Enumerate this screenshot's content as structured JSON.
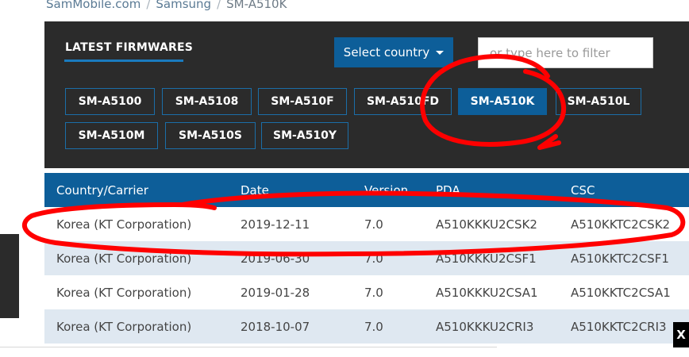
{
  "breadcrumb": {
    "home": "SamMobile.com",
    "brand": "Samsung",
    "model": "SM-A510K"
  },
  "panel": {
    "title": "LATEST FIRMWARES",
    "country_button": "Select country",
    "filter_placeholder": "or type here to filter",
    "models": [
      {
        "label": "SM-A5100",
        "active": false
      },
      {
        "label": "SM-A5108",
        "active": false
      },
      {
        "label": "SM-A510F",
        "active": false
      },
      {
        "label": "SM-A510FD",
        "active": false
      },
      {
        "label": "SM-A510K",
        "active": true
      },
      {
        "label": "SM-A510L",
        "active": false
      },
      {
        "label": "SM-A510M",
        "active": false
      },
      {
        "label": "SM-A510S",
        "active": false
      },
      {
        "label": "SM-A510Y",
        "active": false
      }
    ]
  },
  "table": {
    "headers": [
      "Country/Carrier",
      "Date",
      "Version",
      "PDA",
      "CSC"
    ],
    "rows": [
      [
        "Korea (KT Corporation)",
        "2019-12-11",
        "7.0",
        "A510KKKU2CSK2",
        "A510KKTC2CSK2"
      ],
      [
        "Korea (KT Corporation)",
        "2019-06-30",
        "7.0",
        "A510KKKU2CSF1",
        "A510KKTC2CSF1"
      ],
      [
        "Korea (KT Corporation)",
        "2019-01-28",
        "7.0",
        "A510KKKU2CSA1",
        "A510KKTC2CSA1"
      ],
      [
        "Korea (KT Corporation)",
        "2018-10-07",
        "7.0",
        "A510KKKU2CRI3",
        "A510KKTC2CRI3"
      ]
    ]
  },
  "close_label": "X",
  "colors": {
    "panel_bg": "#2b2b2b",
    "accent": "#0d5e99",
    "row_alt": "#dfe8f1",
    "annotation": "#ff0000"
  }
}
